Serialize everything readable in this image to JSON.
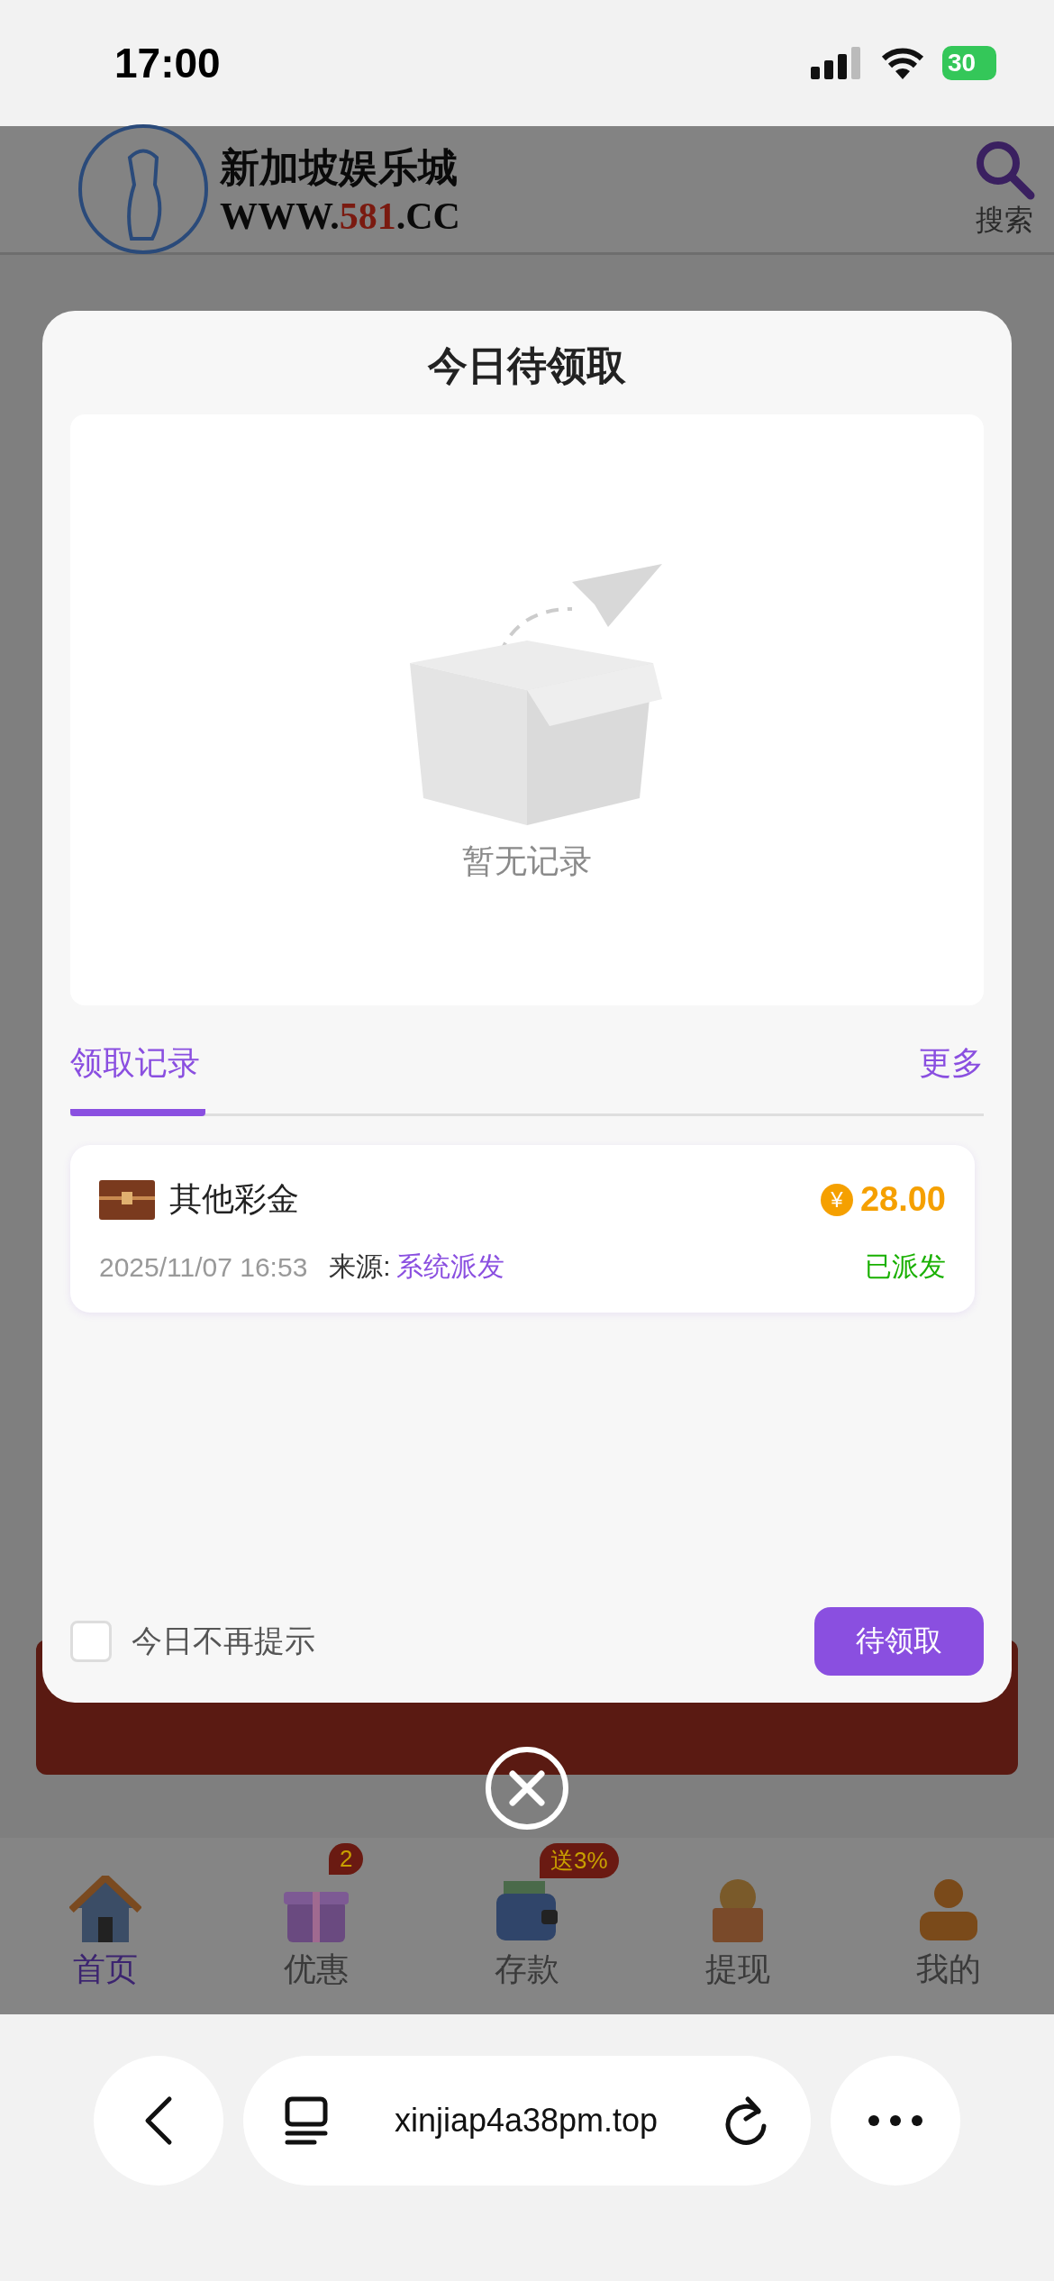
{
  "status_bar": {
    "time": "17:00",
    "battery": "30"
  },
  "site_header": {
    "logo_title": "新加坡娱乐城",
    "logo_url_prefix": "WWW.",
    "logo_url_number": "581",
    "logo_url_suffix": ".CC",
    "search_label": "搜索"
  },
  "dialog": {
    "title": "今日待领取",
    "empty_text": "暂无记录",
    "tabs": [
      {
        "label": "领取记录",
        "selected": true
      }
    ],
    "more_link": "更多",
    "records": [
      {
        "title": "其他彩金",
        "currency_symbol": "¥",
        "amount": "28.00",
        "time": "2025/11/07 16:53",
        "source_label": "来源:",
        "source": "系统派发",
        "status": "已派发"
      }
    ],
    "dont_show_today": {
      "label": "今日不再提示",
      "checked": false
    },
    "claim_button": "待领取"
  },
  "bottom_nav": [
    {
      "kind": "home",
      "label": "首页",
      "selected": true
    },
    {
      "kind": "gift",
      "label": "优惠",
      "selected": false,
      "badge": "2"
    },
    {
      "kind": "wallet",
      "label": "存款",
      "selected": false,
      "badge": "送3%"
    },
    {
      "kind": "withdraw",
      "label": "提现",
      "selected": false
    },
    {
      "kind": "profile",
      "label": "我的",
      "selected": false
    }
  ],
  "browser": {
    "url": "xinjiap4a38pm.top"
  }
}
